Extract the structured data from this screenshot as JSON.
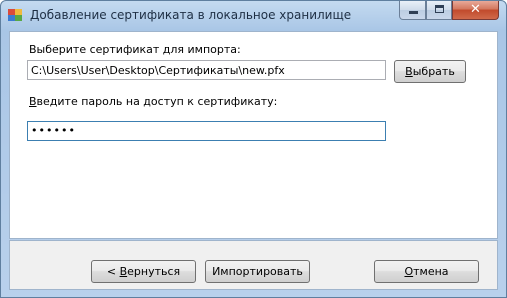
{
  "window": {
    "title": "Добавление сертификата в локальное хранилище",
    "icon": "app-icon",
    "caption_buttons": {
      "minimize_icon": "minimize-icon",
      "maximize_icon": "maximize-icon",
      "close_glyph": "✕"
    }
  },
  "form": {
    "cert_label": "Выберите сертификат для импорта:",
    "cert_path": "C:\\Users\\User\\Desktop\\Сертификаты\\new.pfx",
    "browse_button": {
      "mnemonic": "В",
      "rest": "ыбрать"
    },
    "password_label_mnemonic": "В",
    "password_label_rest": "ведите пароль на доступ к сертификату:",
    "password_value": "••••••"
  },
  "footer": {
    "back_button": {
      "prefix": "< ",
      "mnemonic": "В",
      "rest": "ернуться"
    },
    "import_button": "Импортировать",
    "cancel_button": {
      "mnemonic": "О",
      "rest": "тмена"
    }
  },
  "colors": {
    "title_text": "#1e2f44",
    "frame": "#a9c6e6",
    "close_button": "#c14a2c",
    "focus_border": "#3c7fb1"
  }
}
